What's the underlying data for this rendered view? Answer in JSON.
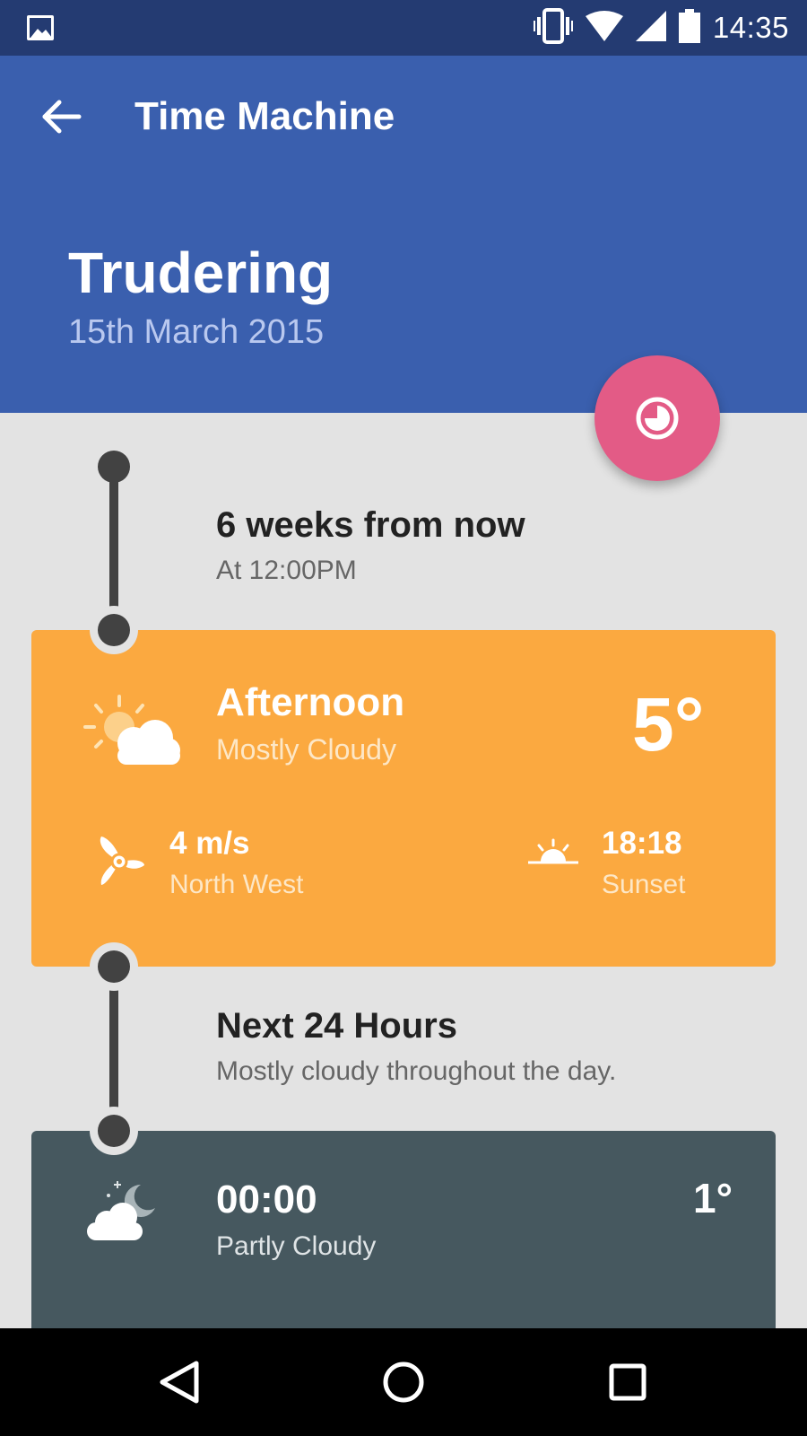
{
  "status_bar": {
    "time": "14:35",
    "icons": [
      "gallery-icon",
      "vibrate-icon",
      "wifi-icon",
      "signal-icon",
      "battery-icon"
    ]
  },
  "app_bar": {
    "back_icon": "arrow-back-icon",
    "title": "Time Machine",
    "location": "Trudering",
    "date": "15th March 2015"
  },
  "fab": {
    "icon": "clock-icon"
  },
  "forecast_header": {
    "title": "6 weeks from now",
    "subtitle": "At 12:00PM"
  },
  "afternoon_card": {
    "icon": "partly-sunny-icon",
    "title": "Afternoon",
    "condition": "Mostly Cloudy",
    "temperature": "5°",
    "wind": {
      "icon": "wind-fan-icon",
      "speed": "4 m/s",
      "direction": "North West"
    },
    "sunset": {
      "icon": "sunset-icon",
      "time": "18:18",
      "label": "Sunset"
    },
    "color": "#fba940"
  },
  "next24": {
    "title": "Next 24 Hours",
    "subtitle": "Mostly cloudy throughout the day."
  },
  "hour_card": {
    "icon": "night-cloud-icon",
    "time": "00:00",
    "condition": "Partly Cloudy",
    "temperature": "1°",
    "color": "#46585f"
  },
  "colors": {
    "status_bar": "#243b72",
    "app_bar": "#3a5fae",
    "accent": "#e35b86",
    "background": "#e3e3e3"
  },
  "nav_bar": {
    "buttons": [
      "back-triangle-icon",
      "home-circle-icon",
      "recents-square-icon"
    ]
  }
}
